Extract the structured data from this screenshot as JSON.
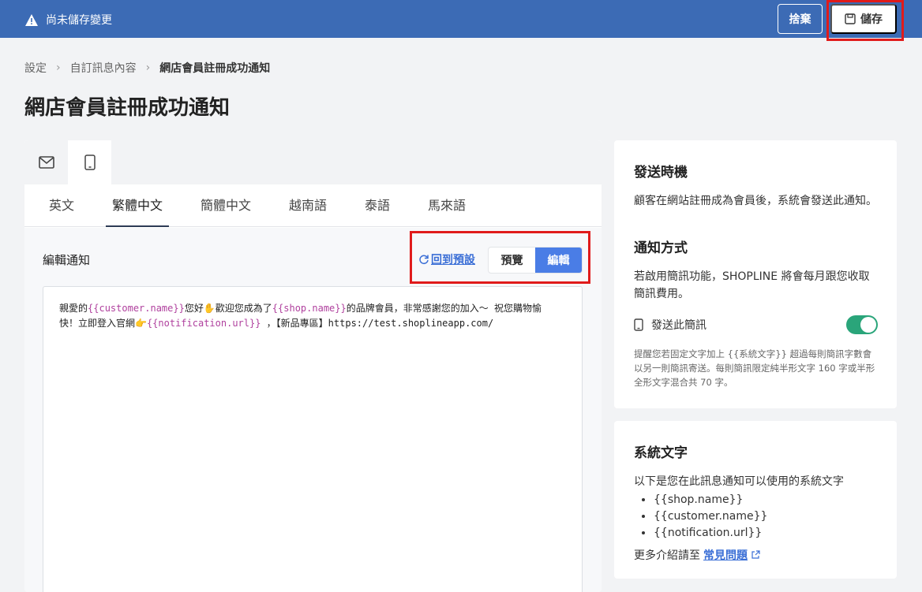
{
  "topbar": {
    "warning_text": "尚未儲存變更",
    "discard_label": "捨棄",
    "save_label": "儲存"
  },
  "breadcrumb": [
    "設定",
    "自訂訊息內容",
    "網店會員註冊成功通知"
  ],
  "page_title": "網店會員註冊成功通知",
  "channels": [
    {
      "icon": "mail-icon",
      "active": false
    },
    {
      "icon": "mobile-icon",
      "active": true
    }
  ],
  "languages": [
    {
      "label": "英文",
      "active": false
    },
    {
      "label": "繁體中文",
      "active": true
    },
    {
      "label": "簡體中文",
      "active": false
    },
    {
      "label": "越南語",
      "active": false
    },
    {
      "label": "泰語",
      "active": false
    },
    {
      "label": "馬來語",
      "active": false
    }
  ],
  "editor": {
    "label": "編輯通知",
    "reset_label": "回到預設",
    "preview_label": "預覽",
    "edit_label": "編輯",
    "content": {
      "p1": "親愛的",
      "v1": "{{customer.name}}",
      "p2": "您好✋歡迎您成為了",
      "v2": "{{shop.name}}",
      "p3": "的品牌會員，非常感謝您的加入～ 祝您購物愉",
      "p4": "快！立即登入官網👉",
      "v3": "{{notification.url}}",
      "p5": " ，【新品專區】https://test.shoplineapp.com/"
    }
  },
  "timing": {
    "title": "發送時機",
    "text": "顧客在網站註冊成為會員後，系統會發送此通知。"
  },
  "method": {
    "title": "通知方式",
    "text_line1": "若啟用簡訊功能，SHOPLINE 將會每月跟您收取",
    "text_line2": "簡訊費用。",
    "sms_label": "發送此簡訊",
    "sms_enabled": true,
    "note": "提醒您若固定文字加上 {{系統文字}} 超過每則簡訊字數會以另一則簡訊寄送。每則簡訊限定純半形文字 160 字或半形全形文字混合共 70 字。"
  },
  "system_vars": {
    "title": "系統文字",
    "intro": "以下是您在此訊息通知可以使用的系統文字",
    "items": [
      "{{shop.name}}",
      "{{customer.name}}",
      "{{notification.url}}"
    ],
    "faq_prefix": "更多介紹請至",
    "faq_link": "常見問題"
  },
  "colors": {
    "topbar": "#3c6bb5",
    "accent": "#4a7de6",
    "toggle_on": "#2aa57a",
    "variable": "#b0419e",
    "highlight_box": "#e01b1b"
  }
}
